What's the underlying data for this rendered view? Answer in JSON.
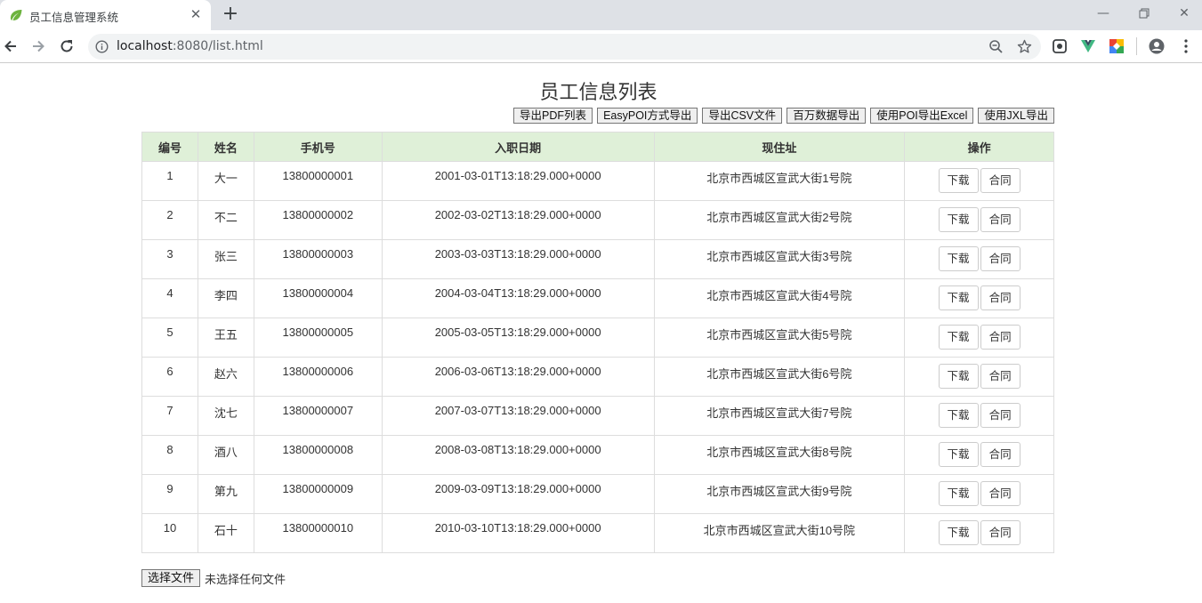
{
  "browser": {
    "tab_title": "员工信息管理系统",
    "url_host": "localhost",
    "url_rest": ":8080/list.html"
  },
  "page": {
    "title": "员工信息列表",
    "export_buttons": [
      "导出PDF列表",
      "EasyPOI方式导出",
      "导出CSV文件",
      "百万数据导出",
      "使用POI导出Excel",
      "使用JXL导出"
    ],
    "columns": [
      "编号",
      "姓名",
      "手机号",
      "入职日期",
      "现住址",
      "操作"
    ],
    "row_actions": {
      "download": "下载",
      "contract": "合同"
    },
    "rows": [
      {
        "id": "1",
        "name": "大一",
        "phone": "13800000001",
        "hire_date": "2001-03-01T13:18:29.000+0000",
        "address": "北京市西城区宣武大街1号院"
      },
      {
        "id": "2",
        "name": "不二",
        "phone": "13800000002",
        "hire_date": "2002-03-02T13:18:29.000+0000",
        "address": "北京市西城区宣武大街2号院"
      },
      {
        "id": "3",
        "name": "张三",
        "phone": "13800000003",
        "hire_date": "2003-03-03T13:18:29.000+0000",
        "address": "北京市西城区宣武大街3号院"
      },
      {
        "id": "4",
        "name": "李四",
        "phone": "13800000004",
        "hire_date": "2004-03-04T13:18:29.000+0000",
        "address": "北京市西城区宣武大街4号院"
      },
      {
        "id": "5",
        "name": "王五",
        "phone": "13800000005",
        "hire_date": "2005-03-05T13:18:29.000+0000",
        "address": "北京市西城区宣武大街5号院"
      },
      {
        "id": "6",
        "name": "赵六",
        "phone": "13800000006",
        "hire_date": "2006-03-06T13:18:29.000+0000",
        "address": "北京市西城区宣武大街6号院"
      },
      {
        "id": "7",
        "name": "沈七",
        "phone": "13800000007",
        "hire_date": "2007-03-07T13:18:29.000+0000",
        "address": "北京市西城区宣武大街7号院"
      },
      {
        "id": "8",
        "name": "酒八",
        "phone": "13800000008",
        "hire_date": "2008-03-08T13:18:29.000+0000",
        "address": "北京市西城区宣武大街8号院"
      },
      {
        "id": "9",
        "name": "第九",
        "phone": "13800000009",
        "hire_date": "2009-03-09T13:18:29.000+0000",
        "address": "北京市西城区宣武大街9号院"
      },
      {
        "id": "10",
        "name": "石十",
        "phone": "13800000010",
        "hire_date": "2010-03-10T13:18:29.000+0000",
        "address": "北京市西城区宣武大街10号院"
      }
    ],
    "file_input": {
      "button_label": "选择文件",
      "status": "未选择任何文件"
    }
  },
  "icons": {
    "favicon": "spring-leaf-icon",
    "back": "back-arrow-icon",
    "forward": "forward-arrow-icon",
    "reload": "reload-icon",
    "info": "info-icon",
    "zoom": "zoom-out-icon",
    "bookmark": "star-icon",
    "account": "account-icon",
    "menu": "kebab-menu-icon"
  },
  "colors": {
    "header_bg": "#dff0d8",
    "favicon_green": "#6db33f",
    "vue_green": "#41b883",
    "vue_dark": "#35495e"
  }
}
